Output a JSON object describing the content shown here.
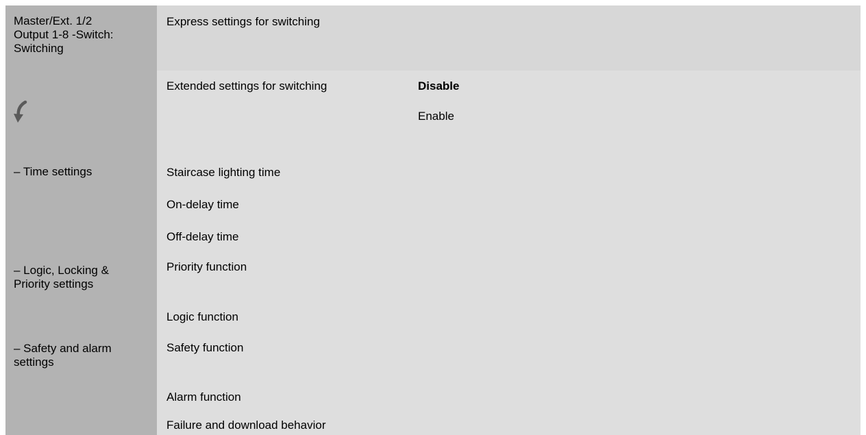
{
  "sidebar": {
    "header_lines": [
      "Master/Ext. 1/2",
      "Output 1-8 -Switch:",
      "Switching"
    ],
    "icon": "undo-arrow-icon",
    "sections": [
      {
        "lines": [
          "– Time settings"
        ]
      },
      {
        "lines": [
          "– Logic, Locking &",
          "Priority settings"
        ]
      },
      {
        "lines": [
          "– Safety and alarm",
          "settings"
        ]
      }
    ]
  },
  "main": {
    "express_label": "Express settings for switching",
    "extended": {
      "label": "Extended settings for switching",
      "options": [
        "Disable",
        "Enable"
      ],
      "selected": "Disable"
    },
    "items": [
      "Staircase lighting time",
      "On-delay time",
      "Off-delay time",
      "Priority function",
      "Logic function",
      "Safety function",
      "Alarm function",
      "Failure and download behavior"
    ]
  },
  "colors": {
    "sidebar_bg": "#b3b3b3",
    "main_bg": "#dedede",
    "header_band_bg": "#d7d7d7",
    "icon_color": "#5a5a5a"
  }
}
